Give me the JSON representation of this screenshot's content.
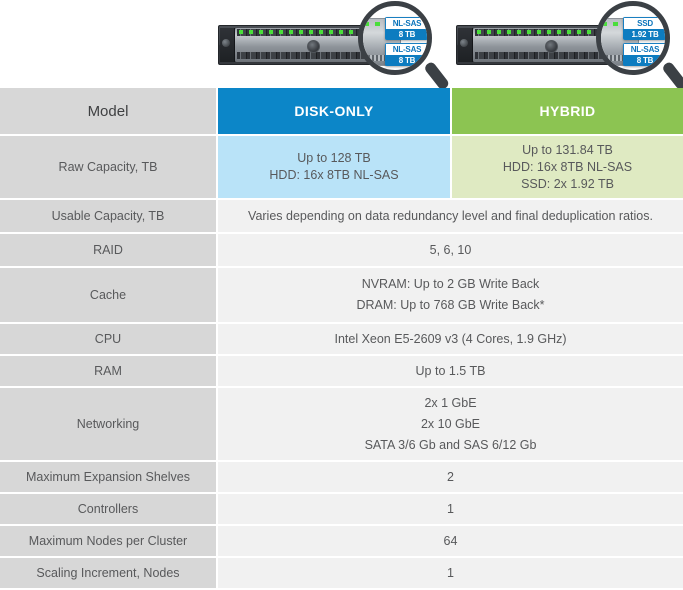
{
  "hero": {
    "units": [
      {
        "name": "disk-only-appliance",
        "badges": [
          {
            "type": "NL-SAS",
            "capacity": "8 TB"
          },
          {
            "type": "NL-SAS",
            "capacity": "8 TB"
          }
        ]
      },
      {
        "name": "hybrid-appliance",
        "badges": [
          {
            "type": "SSD",
            "capacity": "1.92 TB"
          },
          {
            "type": "NL-SAS",
            "capacity": "8 TB"
          }
        ]
      }
    ]
  },
  "colors": {
    "disk_header": "#0c86c8",
    "disk_cell": "#b9e3f8",
    "hybrid_header": "#8cc452",
    "hybrid_cell": "#dfeac2",
    "label_cell": "#d7d7d7",
    "merged_cell": "#f1f1f1",
    "badge_blue": "#0d7cc0",
    "text": "#58595b"
  },
  "table": {
    "header": {
      "label": "Model",
      "disk_only": "DISK-ONLY",
      "hybrid": "HYBRID"
    },
    "raw_capacity": {
      "label": "Raw Capacity, TB",
      "disk_only": [
        "Up to 128 TB",
        "HDD: 16x 8TB NL-SAS"
      ],
      "hybrid": [
        "Up to 131.84 TB",
        "HDD: 16x 8TB NL-SAS",
        "SSD: 2x 1.92 TB"
      ]
    },
    "rows": [
      {
        "label": "Usable Capacity, TB",
        "values": [
          "Varies depending on data redundancy level and final deduplication ratios."
        ]
      },
      {
        "label": "RAID",
        "values": [
          "5, 6, 10"
        ]
      },
      {
        "label": "Cache",
        "values": [
          "NVRAM: Up to 2 GB Write Back",
          "DRAM: Up to 768 GB Write Back*"
        ]
      },
      {
        "label": "CPU",
        "values": [
          "Intel Xeon E5-2609 v3 (4 Cores, 1.9 GHz)"
        ]
      },
      {
        "label": "RAM",
        "values": [
          "Up to 1.5 TB"
        ]
      },
      {
        "label": "Networking",
        "values": [
          "2x 1 GbE",
          "2x 10 GbE",
          "SATA 3/6 Gb and SAS 6/12 Gb"
        ]
      },
      {
        "label": "Maximum Expansion Shelves",
        "values": [
          "2"
        ]
      },
      {
        "label": "Controllers",
        "values": [
          "1"
        ]
      },
      {
        "label": "Maximum Nodes per Cluster",
        "values": [
          "64"
        ]
      },
      {
        "label": "Scaling Increment, Nodes",
        "values": [
          "1"
        ]
      }
    ]
  }
}
